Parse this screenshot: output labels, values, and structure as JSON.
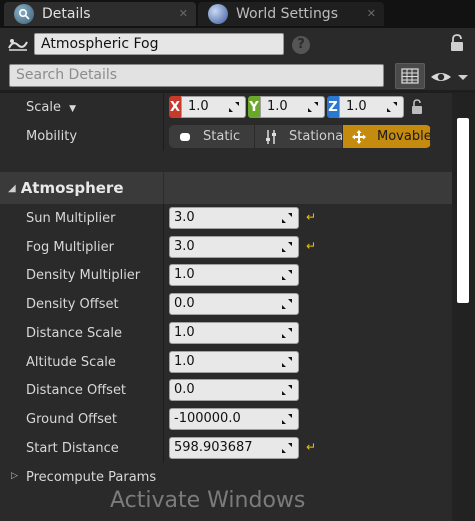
{
  "tabs": [
    {
      "label": "Details",
      "active": true,
      "icon": "magnifier-icon"
    },
    {
      "label": "World Settings",
      "active": false,
      "icon": "globe-icon"
    }
  ],
  "actor": {
    "name": "Atmospheric Fog"
  },
  "search": {
    "placeholder": "Search Details"
  },
  "transform": {
    "scale_label": "Scale",
    "scale": {
      "x": "1.0",
      "y": "1.0",
      "z": "1.0"
    },
    "axis_labels": {
      "x": "X",
      "y": "Y",
      "z": "Z"
    },
    "axis_colors": {
      "x": "#c83a2a",
      "y": "#6aa82a",
      "z": "#2a78d0"
    },
    "mobility_label": "Mobility",
    "mobility_options": [
      "Static",
      "Stationary",
      "Movable"
    ],
    "mobility_selected": "Movable"
  },
  "category": {
    "label": "Atmosphere"
  },
  "properties": [
    {
      "label": "Sun Multiplier",
      "value": "3.0",
      "modified": true
    },
    {
      "label": "Fog Multiplier",
      "value": "3.0",
      "modified": true
    },
    {
      "label": "Density Multiplier",
      "value": "1.0",
      "modified": false
    },
    {
      "label": "Density Offset",
      "value": "0.0",
      "modified": false
    },
    {
      "label": "Distance Scale",
      "value": "1.0",
      "modified": false
    },
    {
      "label": "Altitude Scale",
      "value": "1.0",
      "modified": false
    },
    {
      "label": "Distance Offset",
      "value": "0.0",
      "modified": false
    },
    {
      "label": "Ground Offset",
      "value": "-100000.0",
      "modified": false
    },
    {
      "label": "Start Distance",
      "value": "598.903687",
      "modified": true
    }
  ],
  "collapsed_group": {
    "label": "Precompute Params"
  },
  "watermark": "Activate Windows",
  "colors": {
    "accent_selected": "#c58b0f",
    "reset_arrow": "#e8c200"
  }
}
